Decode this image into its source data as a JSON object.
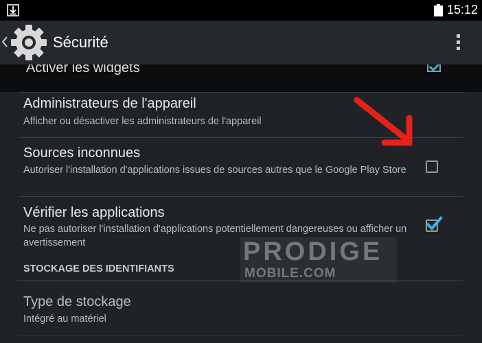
{
  "status_bar": {
    "time": "15:12",
    "left_icon": "download-icon",
    "right_icon": "battery-icon"
  },
  "action_bar": {
    "title": "Sécurité",
    "icon": "gear-icon",
    "back_icon": "chevron-left-icon",
    "menu_icon": "overflow-menu-icon"
  },
  "settings": {
    "partial_item": {
      "title": "Activer les widgets",
      "checked": true
    },
    "device_admins": {
      "title": "Administrateurs de l'appareil",
      "summary": "Afficher ou désactiver les administrateurs de l'appareil"
    },
    "unknown_sources": {
      "title": "Sources inconnues",
      "summary": "Autoriser l'installation d'applications issues de sources autres que le Google Play Store",
      "checked": false
    },
    "verify_apps": {
      "title": "Vérifier les applications",
      "summary": "Ne pas autoriser l'installation d'applications potentiellement dangereuses ou afficher un avertissement",
      "checked": true
    },
    "credential_storage_header": "STOCKAGE DES IDENTIFIANTS",
    "storage_type": {
      "title": "Type de stockage",
      "summary": "Intégré au matériel"
    }
  },
  "watermark": {
    "line1": "PRODIGE",
    "line2": "MOBILE.COM"
  },
  "colors": {
    "background": "#1f2226",
    "action_bar": "#25282c",
    "checkbox_accent": "#33b5e5",
    "arrow": "#e8201a"
  }
}
